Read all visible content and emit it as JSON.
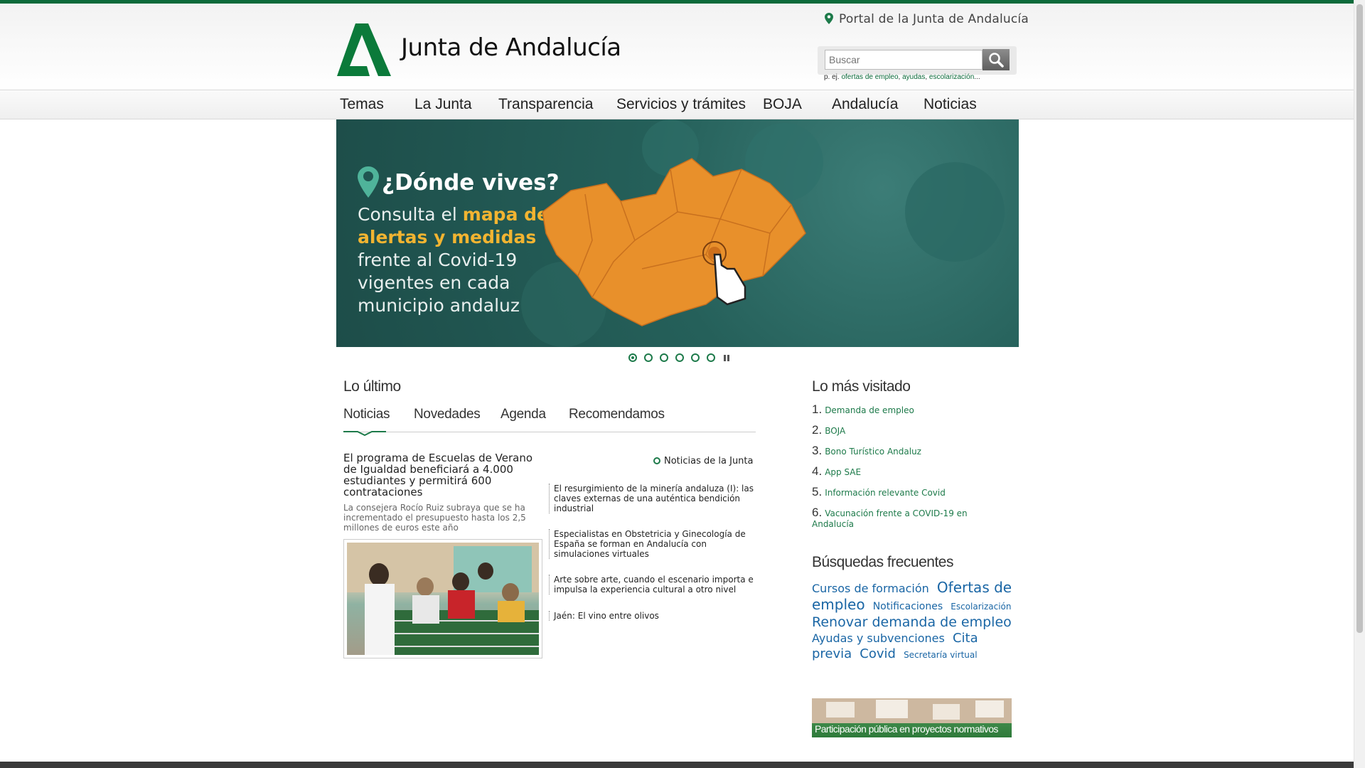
{
  "header": {
    "logo_text": "Junta de Andalucía",
    "portal_link": "Portal de la Junta de Andalucía",
    "search": {
      "placeholder": "Buscar"
    },
    "search_hint": {
      "prefix": "p. ej. ",
      "links": [
        "ofertas de empleo",
        "ayudas",
        "escolarización"
      ],
      "suffix": "..."
    }
  },
  "nav": {
    "items": [
      "Temas",
      "La Junta",
      "Transparencia",
      "Servicios y trámites",
      "BOJA",
      "Andalucía",
      "Noticias"
    ]
  },
  "hero": {
    "title": "¿Dónde vives?",
    "text_pre": "Consulta el ",
    "text_highlight": "mapa de alertas y medidas",
    "text_post": " frente al Covid-19 vigentes en cada municipio andaluz"
  },
  "slider": {
    "count": 6,
    "active": 1
  },
  "lo_ultimo": {
    "title": "Lo último",
    "tabs": [
      "Noticias",
      "Novedades",
      "Agenda",
      "Recomendamos"
    ],
    "active_tab": "Noticias",
    "more_link": "Noticias de la Junta",
    "main_headline": "El programa de Escuelas de Verano de Igualdad beneficiará a 4.000 estudiantes y permitirá 600 contrataciones",
    "main_summary": "La consejera Rocío Ruiz subraya que se ha incrementado el presupuesto hasta los 2,5 millones de euros este año",
    "side_news": [
      "El resurgimiento de la minería andaluza (I): las claves externas de una auténtica bendición industrial",
      "Especialistas en Obstetricia y Ginecología de España se forman en Andalucía con simulaciones virtuales",
      "Arte sobre arte, cuando el escenario importa e impulsa la experiencia cultural a otro nivel",
      "Jaén: El vino entre olivos"
    ]
  },
  "mas_visitado": {
    "title": "Lo más visitado",
    "items": [
      {
        "n": "1.",
        "label": "Demanda de empleo"
      },
      {
        "n": "2.",
        "label": "BOJA"
      },
      {
        "n": "3.",
        "label": "Bono Turístico Andaluz"
      },
      {
        "n": "4.",
        "label": "App SAE"
      },
      {
        "n": "5.",
        "label": "Información relevante Covid"
      },
      {
        "n": "6.",
        "label": "Vacunación frente a COVID-19 en Andalucía"
      }
    ]
  },
  "busquedas": {
    "title": "Búsquedas frecuentes",
    "tags": [
      {
        "label": "Cursos de formación",
        "size": 16
      },
      {
        "label": "Ofertas de empleo",
        "size": 20
      },
      {
        "label": "Notificaciones",
        "size": 14
      },
      {
        "label": "Escolarización",
        "size": 12
      },
      {
        "label": "Renovar demanda de empleo",
        "size": 19
      },
      {
        "label": "Ayudas y subvenciones",
        "size": 16
      },
      {
        "label": "Cita previa",
        "size": 18
      },
      {
        "label": "Covid",
        "size": 18
      },
      {
        "label": "Secretaría virtual",
        "size": 12
      }
    ]
  },
  "banner": {
    "text": "Participación pública en proyectos normativos"
  },
  "colors": {
    "brand_green": "#0b6a3a",
    "link_green": "#1d7a4a",
    "tag_blue": "#1a66a5",
    "hero_orange": "#e8902b"
  }
}
